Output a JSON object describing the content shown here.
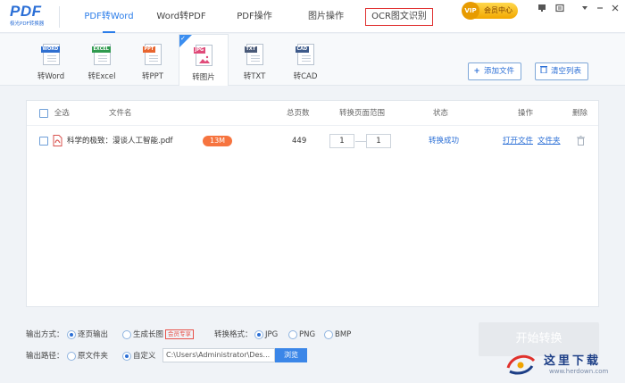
{
  "app": {
    "logo_text": "PDF",
    "logo_sub": "极光PDF转换器"
  },
  "nav_tabs": [
    {
      "label": "PDF转Word",
      "active": true
    },
    {
      "label": "Word转PDF",
      "active": false
    },
    {
      "label": "PDF操作",
      "active": false
    },
    {
      "label": "图片操作",
      "active": false
    },
    {
      "label": "OCR图文识别",
      "active": false,
      "highlighted": true
    }
  ],
  "header": {
    "vip_label": "会员中心",
    "vip_badge": "VIP"
  },
  "tools": [
    {
      "label": "转Word",
      "badge": "WORD",
      "color": "#2f6fd0",
      "active": false
    },
    {
      "label": "转Excel",
      "badge": "EXCEL",
      "color": "#2f9a4e",
      "active": false
    },
    {
      "label": "转PPT",
      "badge": "PPT",
      "color": "#e8652f",
      "active": false
    },
    {
      "label": "转图片",
      "badge": "JPG",
      "color": "#e04b7a",
      "active": true
    },
    {
      "label": "转TXT",
      "badge": "TXT",
      "color": "#4a5a78",
      "active": false
    },
    {
      "label": "转CAD",
      "badge": "CAD",
      "color": "#3d5a8a",
      "active": false
    }
  ],
  "actions": {
    "add_file": "添加文件",
    "clear_list": "清空列表"
  },
  "table": {
    "headers": {
      "select_all": "全选",
      "file_name": "文件名",
      "total_pages": "总页数",
      "page_range": "转换页面范围",
      "status": "状态",
      "operation": "操作",
      "delete": "删除"
    },
    "rows": [
      {
        "file_name": "科学的极致：漫谈人工智能.pdf",
        "size": "13M",
        "total_pages": "449",
        "range_from": "1",
        "range_to": "1",
        "status": "转换成功",
        "open_file": "打开文件",
        "folder": "文件夹"
      }
    ]
  },
  "output": {
    "mode_label": "输出方式：",
    "mode_per_page": "逐页输出",
    "mode_long_image": "生成长图",
    "vip_tag": "会员专享",
    "format_label": "转换格式：",
    "formats": [
      "JPG",
      "PNG",
      "BMP"
    ],
    "path_label": "输出路径：",
    "path_original": "原文件夹",
    "path_custom": "自定义",
    "path_value": "C:\\Users\\Administrator\\Des...",
    "browse": "浏览",
    "start": "开始转换"
  },
  "watermark": {
    "title": "这里下载",
    "url": "www.herdown.com"
  }
}
